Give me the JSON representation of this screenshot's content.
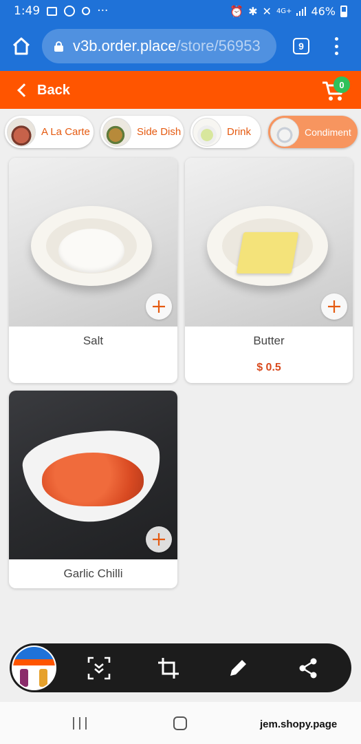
{
  "status_bar": {
    "time": "1:49",
    "battery": "46%",
    "network": "4G+"
  },
  "browser": {
    "url_host": "v3b.order.place",
    "url_path": "/store/56953",
    "tab_count": "9"
  },
  "header": {
    "back_label": "Back",
    "cart_count": "0"
  },
  "categories": [
    {
      "label": "A La Carte",
      "icon": "a-la-carte-thumb",
      "active": false
    },
    {
      "label": "Side Dish",
      "icon": "side-dish-thumb",
      "active": false
    },
    {
      "label": "Drink",
      "icon": "drink-thumb",
      "active": false
    },
    {
      "label": "Condiment",
      "icon": "condiment-thumb",
      "active": true
    }
  ],
  "products": [
    {
      "name": "Salt",
      "price": ""
    },
    {
      "name": "Butter",
      "price": "$ 0.5"
    },
    {
      "name": "Garlic Chilli",
      "price": ""
    }
  ],
  "screenshot_toolbar": {
    "tools": [
      "scroll-capture-icon",
      "crop-icon",
      "edit-icon",
      "share-icon"
    ]
  },
  "watermark": "jem.shopy.page",
  "colors": {
    "browser_blue": "#1f72d8",
    "header_orange": "#ff5500",
    "active_pill": "#f7955f",
    "badge_green": "#2fc15a",
    "price_orange": "#d94a1e"
  }
}
